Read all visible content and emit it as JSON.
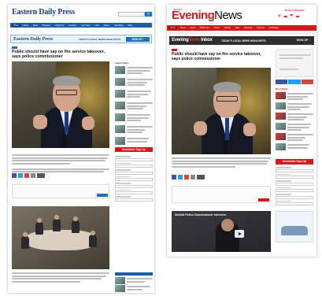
{
  "left_page": {
    "masthead": "Eastern Daily Press",
    "nav": [
      "Home",
      "News",
      "Sport",
      "Business",
      "Going Out",
      "Property",
      "Your Town",
      "Jobs",
      "Motors",
      "Weddings",
      "Shop"
    ],
    "promo": {
      "title": "Eastern Daily Press",
      "mid": "TODAY'S LOCAL NEWS HIGHLIGHTS",
      "button": "SIGN UP ›"
    },
    "headline": "Public should have say on fire service takeover, says police commissioner",
    "side_heading": "Latest News",
    "newsletter_button": "Newsletter Sign Up",
    "colors": {
      "brand": "#1d5da8",
      "accent": "#1d6fc4",
      "newsletter": "#d11a1a"
    }
  },
  "right_page": {
    "edition": "Norwich",
    "masthead_red": "Evening",
    "masthead_dark": "News",
    "weather_label": "Norwich Weather",
    "nav": [
      "Home",
      "News",
      "Sport",
      "What's On",
      "Travel",
      "Videos",
      "Jobs",
      "Motoring",
      "Property",
      "Weddings"
    ],
    "promo": {
      "title_white": "Evening",
      "title_red": "News",
      "title_tail": "Inbox",
      "mid": "TODAY'S LOCAL NEWS HIGHLIGHTS",
      "button": "SIGN UP",
      "button_arrow": "›"
    },
    "headline": "Public should have say on fire service takeover, says police commissioner",
    "side_heading": "Most Read",
    "newsletter_button": "Newsletter Sign Up",
    "video_title": "Norfolk Police Commissioner interview",
    "colors": {
      "brand": "#d11a1a",
      "dark": "#2d2d2d"
    }
  }
}
